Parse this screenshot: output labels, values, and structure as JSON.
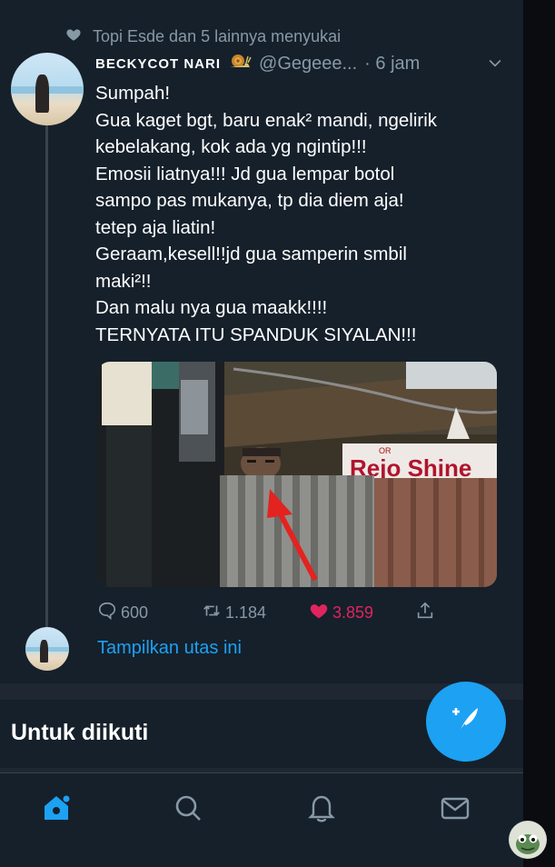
{
  "social_context": {
    "icon": "heart-icon",
    "text": "Topi Esde dan 5 lainnya menyukai"
  },
  "tweet": {
    "display_name": "BECKYCOT NARI",
    "name_emoji": "snail-icon",
    "handle": "@Gegeee...",
    "time": "· 6 jam",
    "lines": [
      "Sumpah!",
      "Gua kaget bgt, baru enak² mandi, ngelirik",
      "kebelakang, kok ada yg ngintip!!!",
      "Emosii liatnya!!! Jd gua lempar botol",
      "sampo pas mukanya, tp dia diem aja!",
      "tetep aja liatin!",
      "Geraam,kesell!!jd gua samperin smbil",
      "maki²!!",
      "Dan malu nya gua maakk!!!!",
      "TERNYATA ITU SPANDUK SIYALAN!!!"
    ],
    "media": {
      "banner_text": "Rejo Shine",
      "banner_small": "OR"
    },
    "actions": {
      "replies": "600",
      "retweets": "1.184",
      "likes": "3.859"
    },
    "show_thread": "Tampilkan utas ini"
  },
  "section": {
    "title": "Untuk diikuti"
  },
  "nav": {
    "items": [
      "home-icon",
      "search-icon",
      "notifications-icon",
      "messages-icon"
    ]
  },
  "colors": {
    "background": "#15202b",
    "accent": "#1da1f2",
    "like": "#e0245e",
    "muted": "#8899a6"
  }
}
